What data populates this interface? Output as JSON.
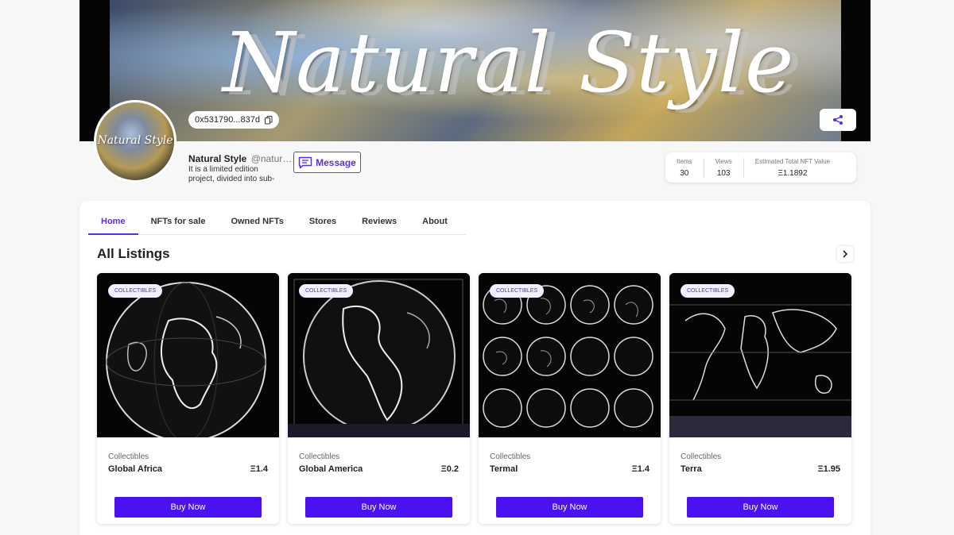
{
  "banner": {
    "title": "Natural Style"
  },
  "avatar": {
    "text": "Natural Style"
  },
  "profile": {
    "address": "0x531790...837d",
    "name": "Natural Style",
    "handle": "@natur…",
    "description": "It is a limited edition project, divided into sub-",
    "message_label": "Message"
  },
  "stats": [
    {
      "label": "Items",
      "value": "30"
    },
    {
      "label": "Views",
      "value": "103"
    },
    {
      "label": "Estimated Total NFT Value",
      "value": "Ξ1.1892"
    }
  ],
  "tabs": [
    {
      "label": "Home",
      "active": true
    },
    {
      "label": "NFTs for sale",
      "active": false
    },
    {
      "label": "Owned NFTs",
      "active": false
    },
    {
      "label": "Stores",
      "active": false
    },
    {
      "label": "Reviews",
      "active": false
    },
    {
      "label": "About",
      "active": false
    }
  ],
  "section": {
    "title": "All Listings",
    "next_icon": "chevron-right-icon"
  },
  "listings": [
    {
      "badge": "COLLECTIBLES",
      "category": "Collectibles",
      "name": "Global Africa",
      "price": "Ξ1.4",
      "buy_label": "Buy Now",
      "image": "globe-africa"
    },
    {
      "badge": "COLLECTIBLES",
      "category": "Collectibles",
      "name": "Global America",
      "price": "Ξ0.2",
      "buy_label": "Buy Now",
      "image": "globe-america"
    },
    {
      "badge": "COLLECTIBLES",
      "category": "Collectibles",
      "name": "Termal",
      "price": "Ξ1.4",
      "buy_label": "Buy Now",
      "image": "globe-grid"
    },
    {
      "badge": "COLLECTIBLES",
      "category": "Collectibles",
      "name": "Terra",
      "price": "Ξ1.95",
      "buy_label": "Buy Now",
      "image": "world-map"
    }
  ],
  "colors": {
    "accent": "#5a2ee0",
    "button": "#4a12f0"
  }
}
